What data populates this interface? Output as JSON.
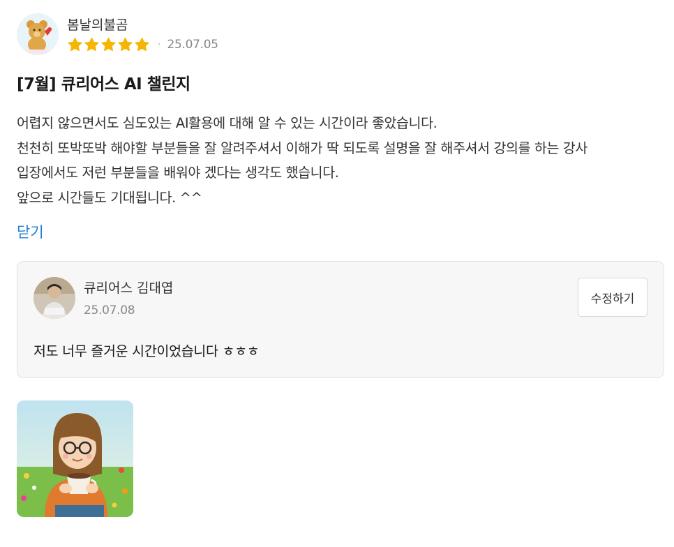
{
  "review": {
    "author": "봄날의불곰",
    "rating": 5,
    "rating_max": 5,
    "separator": "·",
    "date": "25.07.05",
    "title": "[7월] 큐리어스 AI 챌린지",
    "body_lines": [
      "어렵지 않으면서도 심도있는 AI활용에 대해 알 수 있는 시간이라 좋았습니다.",
      "천천히 또박또박 해야할 부분들을 잘 알려주셔서 이해가 딱 되도록 설명을 잘 해주셔서 강의를 하는 강사",
      "입장에서도 저런 부분들을 배워야 겠다는 생각도 했습니다.",
      "앞으로 시간들도 기대됩니다. ^^"
    ],
    "close_label": "닫기",
    "star_color": "#f6b500",
    "link_color": "#1f7fd6"
  },
  "reply": {
    "author": "큐리어스 김대엽",
    "date": "25.07.08",
    "edit_label": "수정하기",
    "text": "저도 너무 즐거운 시간이었습니다 ㅎㅎㅎ"
  },
  "icons": {
    "star": "star-icon",
    "avatar": "teddy-bear-avatar",
    "reply_avatar": "person-photo-avatar",
    "attachment": "illustration-girl-with-coffee"
  }
}
